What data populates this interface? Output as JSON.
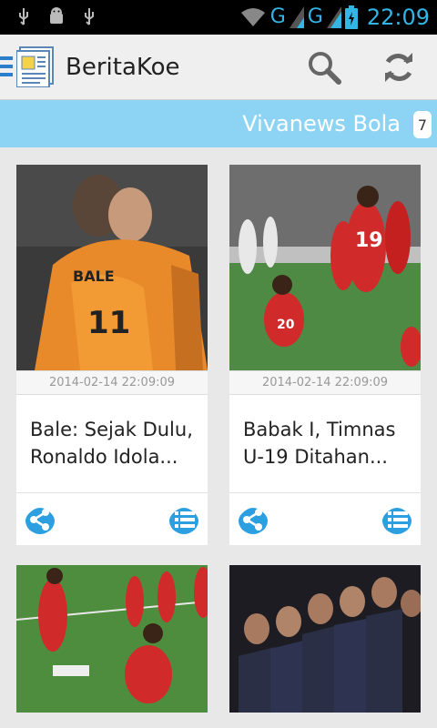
{
  "status_bar": {
    "network_1": "G",
    "network_2": "G",
    "time": "22:09"
  },
  "app": {
    "title": "BeritaKoe"
  },
  "category": {
    "title": "Vivanews Bola",
    "badge": "7"
  },
  "articles": [
    {
      "date": "2014-02-14 22:09:09",
      "title": "Bale: Sejak Dulu, Ronaldo Idola..."
    },
    {
      "date": "2014-02-14 22:09:09",
      "title": "Babak I, Timnas U-19 Ditahan..."
    }
  ],
  "colors": {
    "accent": "#33b5e5",
    "category_bar": "#8dd4f4",
    "icon_blue": "#2b9fe0"
  }
}
